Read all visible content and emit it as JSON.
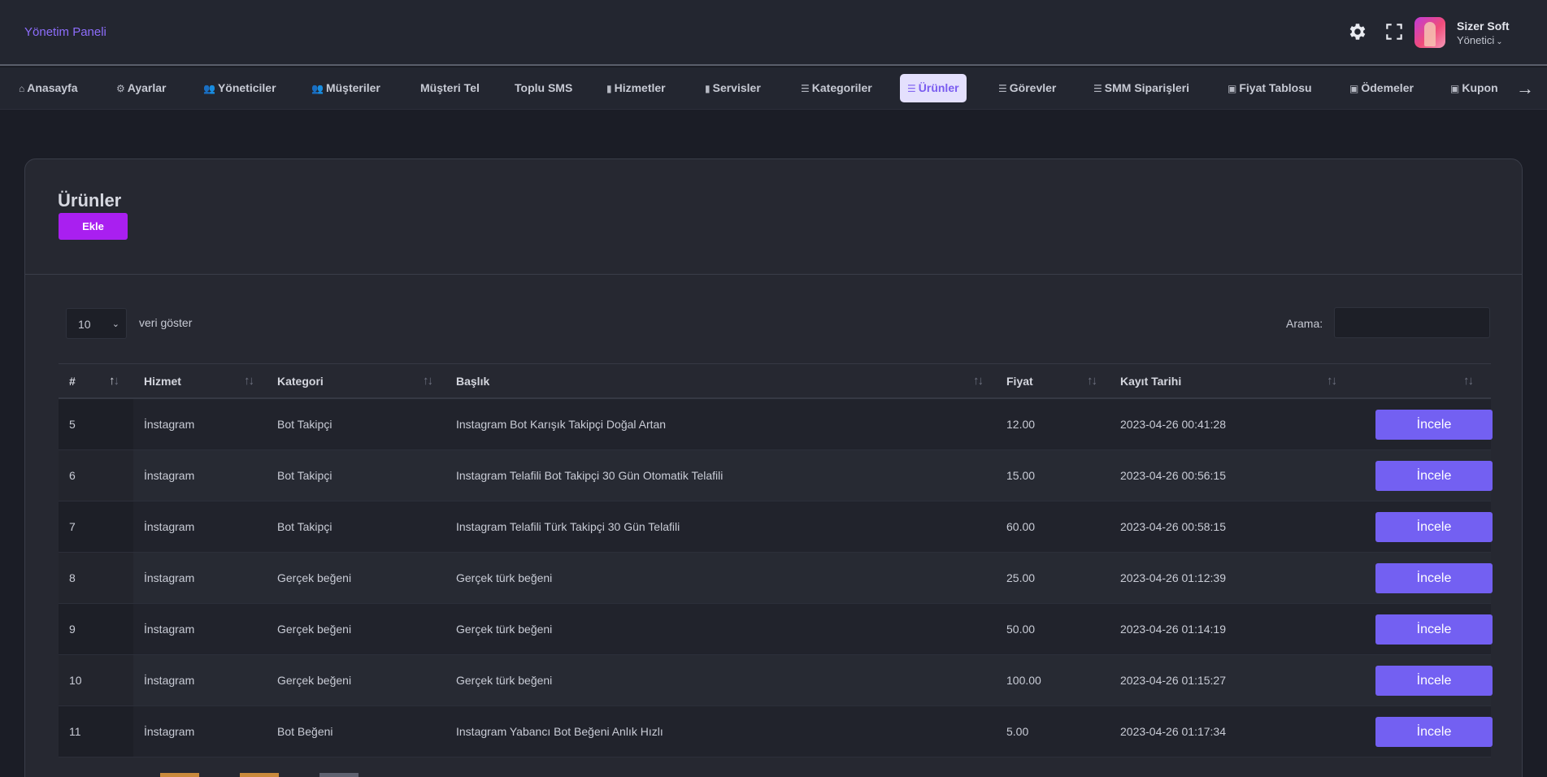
{
  "header": {
    "brand": "Yönetim Paneli",
    "user": {
      "name": "Sizer Soft",
      "role": "Yönetici"
    },
    "icons": [
      "gear-icon",
      "fullscreen-icon",
      "avatar"
    ]
  },
  "nav": {
    "items": [
      {
        "label": "Anasayfa",
        "icon": "home-icon",
        "glyph": "⌂"
      },
      {
        "label": "Ayarlar",
        "icon": "cogs-icon",
        "glyph": "⚙"
      },
      {
        "label": "Yöneticiler",
        "icon": "users-icon",
        "glyph": "👥"
      },
      {
        "label": "Müşteriler",
        "icon": "users-icon",
        "glyph": "👥"
      },
      {
        "label": "Müşteri Tel",
        "icon": "",
        "glyph": ""
      },
      {
        "label": "Toplu SMS",
        "icon": "",
        "glyph": ""
      },
      {
        "label": "Hizmetler",
        "icon": "building-icon",
        "glyph": "▮"
      },
      {
        "label": "Servisler",
        "icon": "building-icon",
        "glyph": "▮"
      },
      {
        "label": "Kategoriler",
        "icon": "list-icon",
        "glyph": "☰"
      },
      {
        "label": "Ürünler",
        "icon": "list-icon",
        "glyph": "☰",
        "active": true
      },
      {
        "label": "Görevler",
        "icon": "list-icon",
        "glyph": "☰"
      },
      {
        "label": "SMM Siparişleri",
        "icon": "list-icon",
        "glyph": "☰"
      },
      {
        "label": "Fiyat Tablosu",
        "icon": "money-icon",
        "glyph": "▣"
      },
      {
        "label": "Ödemeler",
        "icon": "money-icon",
        "glyph": "▣"
      },
      {
        "label": "Kupon",
        "icon": "money-icon",
        "glyph": "▣"
      }
    ],
    "scroll_arrow": "→"
  },
  "page": {
    "title": "Ürünler",
    "add_button": "Ekle",
    "length_value": "10",
    "length_label": "veri göster",
    "search_label": "Arama:",
    "search_value": ""
  },
  "table": {
    "columns": [
      "#",
      "Hizmet",
      "Kategori",
      "Başlık",
      "Fiyat",
      "Kayıt Tarihi",
      ""
    ],
    "action_label": "İncele",
    "rows": [
      {
        "id": "5",
        "service": "İnstagram",
        "category": "Bot Takipçi",
        "title": "Instagram Bot Karışık Takipçi Doğal Artan",
        "price": "12.00",
        "date": "2023-04-26 00:41:28"
      },
      {
        "id": "6",
        "service": "İnstagram",
        "category": "Bot Takipçi",
        "title": "Instagram Telafili Bot Takipçi 30 Gün Otomatik Telafili",
        "price": "15.00",
        "date": "2023-04-26 00:56:15"
      },
      {
        "id": "7",
        "service": "İnstagram",
        "category": "Bot Takipçi",
        "title": "Instagram Telafili Türk Takipçi 30 Gün Telafili",
        "price": "60.00",
        "date": "2023-04-26 00:58:15"
      },
      {
        "id": "8",
        "service": "İnstagram",
        "category": "Gerçek beğeni",
        "title": "Gerçek türk beğeni",
        "price": "25.00",
        "date": "2023-04-26 01:12:39"
      },
      {
        "id": "9",
        "service": "İnstagram",
        "category": "Gerçek beğeni",
        "title": "Gerçek türk beğeni",
        "price": "50.00",
        "date": "2023-04-26 01:14:19"
      },
      {
        "id": "10",
        "service": "İnstagram",
        "category": "Gerçek beğeni",
        "title": "Gerçek türk beğeni",
        "price": "100.00",
        "date": "2023-04-26 01:15:27"
      },
      {
        "id": "11",
        "service": "İnstagram",
        "category": "Bot Beğeni",
        "title": "Instagram Yabancı Bot Beğeni Anlık Hızlı",
        "price": "5.00",
        "date": "2023-04-26 01:17:34"
      }
    ]
  },
  "colors": {
    "accent": "#7360f2",
    "add_button": "#a91ff0",
    "brand_text": "#8d6dfb",
    "active_nav_bg": "#e4e0fd"
  }
}
